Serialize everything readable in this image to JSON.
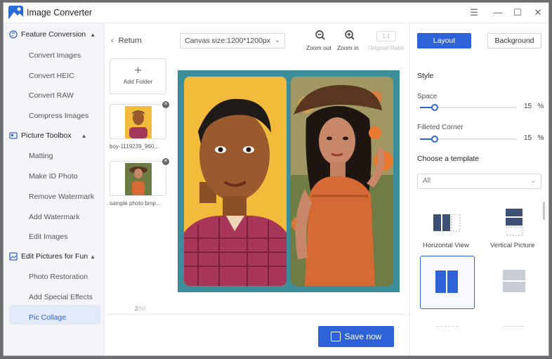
{
  "app": {
    "title": "Image Converter"
  },
  "window_controls": {
    "menu": "☰",
    "minimize": "—",
    "maximize": "☐",
    "close": "✕"
  },
  "sidebar": {
    "sections": [
      {
        "label": "Feature Conversion",
        "items": [
          "Convert Images",
          "Convert HEIC",
          "Convert RAW",
          "Compress Images"
        ]
      },
      {
        "label": "Picture Toolbox",
        "items": [
          "Matting",
          "Make ID Photo",
          "Remove Watermark",
          "Add Watermark",
          "Edit Images"
        ]
      },
      {
        "label": "Edit Pictures for Fun",
        "items": [
          "Photo Restoration",
          "Add Special Effects",
          "Pic Collage"
        ]
      }
    ],
    "active_item": "Pic Collage"
  },
  "toolbar": {
    "return_label": "Return",
    "canvas_size": "Canvas size:1200*1200px",
    "zoom_out_label": "Zoom out",
    "zoom_in_label": "Zoom in",
    "ratio_button": "1:1",
    "original_ratio_label": "Original Ratio"
  },
  "thumbnails": {
    "add_folder_label": "Add Folder",
    "items": [
      {
        "name": "boy-1119239_960..."
      },
      {
        "name": "sample photo bmp..."
      }
    ],
    "page_current": "2",
    "page_total": "/50"
  },
  "bottom": {
    "save_label": "Save now"
  },
  "right_panel": {
    "tabs": {
      "layout": "Layout",
      "background": "Background"
    },
    "style_heading": "Style",
    "space_label": "Space",
    "space_value": "15",
    "space_unit": "%",
    "space_fraction": 0.15,
    "corner_label": "Filleted Corner",
    "corner_value": "15",
    "corner_unit": "%",
    "corner_fraction": 0.15,
    "template_heading": "Choose a template",
    "template_filter": "All",
    "templates": {
      "horizontal": "Horizontal View",
      "vertical": "Vertical Picture"
    }
  },
  "colors": {
    "accent": "#2d62d8",
    "canvas_bg": "#3c8f9a",
    "left_photo_bg": "#f2bb3c"
  }
}
